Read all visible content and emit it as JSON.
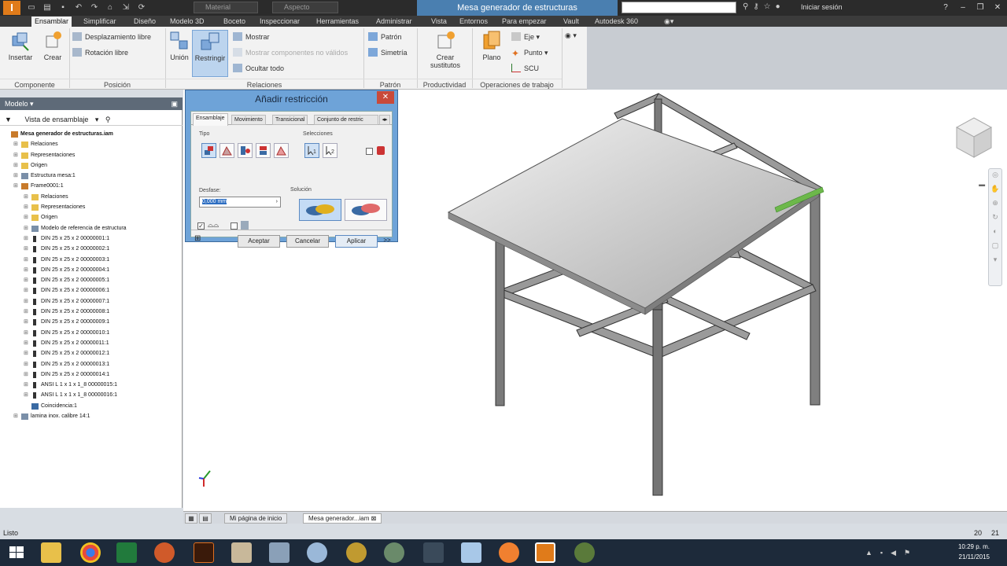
{
  "titlebar": {
    "app_logo": "I",
    "material_placeholder": "Material",
    "appearance_placeholder": "Aspecto",
    "title": "Mesa generador de estructuras",
    "sign_in": "Iniciar sesión"
  },
  "tabs": [
    "Ensamblar",
    "Simplificar",
    "Diseño",
    "Modelo 3D",
    "Boceto",
    "Inspeccionar",
    "Herramientas",
    "Administrar",
    "Vista",
    "Entornos",
    "Para empezar",
    "Vault",
    "Autodesk 360"
  ],
  "ribbon": {
    "insert": "Insertar",
    "create": "Crear",
    "free_move": "Desplazamiento libre",
    "free_rotate": "Rotación libre",
    "join": "Unión",
    "constrain": "Restringir",
    "show": "Mostrar",
    "show_disabled": "Mostrar componentes no válidos",
    "hide_all": "Ocultar todo",
    "pattern": "Patrón",
    "mirror": "Simetría",
    "create_subs_1": "Crear",
    "create_subs_2": "sustitutos",
    "plane": "Plano",
    "axis": "Eje",
    "point": "Punto",
    "ucs": "SCU",
    "panels": {
      "component": "Componente",
      "position": "Posición",
      "relations": "Relaciones",
      "pattern": "Patrón",
      "productivity": "Productividad",
      "work_features": "Operaciones de trabajo"
    }
  },
  "browser": {
    "header": "Modelo",
    "view": "Vista de ensamblaje",
    "tree": [
      {
        "label": "Mesa generador de estructuras.iam",
        "level": 0,
        "bold": true,
        "icon": "assembly-icon"
      },
      {
        "label": "Relaciones",
        "level": 1,
        "icon": "folder-icon"
      },
      {
        "label": "Representaciones",
        "level": 1,
        "icon": "folder-icon"
      },
      {
        "label": "Origen",
        "level": 1,
        "icon": "folder-icon"
      },
      {
        "label": "Estructura mesa:1",
        "level": 1,
        "icon": "part-icon"
      },
      {
        "label": "Frame0001:1",
        "level": 1,
        "icon": "assembly-icon"
      },
      {
        "label": "Relaciones",
        "level": 2,
        "icon": "folder-icon"
      },
      {
        "label": "Representaciones",
        "level": 2,
        "icon": "folder-icon"
      },
      {
        "label": "Origen",
        "level": 2,
        "icon": "folder-icon"
      },
      {
        "label": "Modelo de referencia de estructura",
        "level": 2,
        "icon": "part-icon"
      },
      {
        "label": "DIN 25 x 25 x 2 00000001:1",
        "level": 2,
        "icon": "beam-icon"
      },
      {
        "label": "DIN 25 x 25 x 2 00000002:1",
        "level": 2,
        "icon": "beam-icon"
      },
      {
        "label": "DIN 25 x 25 x 2 00000003:1",
        "level": 2,
        "icon": "beam-icon"
      },
      {
        "label": "DIN 25 x 25 x 2 00000004:1",
        "level": 2,
        "icon": "beam-icon"
      },
      {
        "label": "DIN 25 x 25 x 2 00000005:1",
        "level": 2,
        "icon": "beam-icon"
      },
      {
        "label": "DIN 25 x 25 x 2 00000006:1",
        "level": 2,
        "icon": "beam-icon"
      },
      {
        "label": "DIN 25 x 25 x 2 00000007:1",
        "level": 2,
        "icon": "beam-icon"
      },
      {
        "label": "DIN 25 x 25 x 2 00000008:1",
        "level": 2,
        "icon": "beam-icon"
      },
      {
        "label": "DIN 25 x 25 x 2 00000009:1",
        "level": 2,
        "icon": "beam-icon"
      },
      {
        "label": "DIN 25 x 25 x 2 00000010:1",
        "level": 2,
        "icon": "beam-icon"
      },
      {
        "label": "DIN 25 x 25 x 2 00000011:1",
        "level": 2,
        "icon": "beam-icon"
      },
      {
        "label": "DIN 25 x 25 x 2 00000012:1",
        "level": 2,
        "icon": "beam-icon"
      },
      {
        "label": "DIN 25 x 25 x 2 00000013:1",
        "level": 2,
        "icon": "beam-icon"
      },
      {
        "label": "DIN 25 x 25 x 2 00000014:1",
        "level": 2,
        "icon": "beam-icon"
      },
      {
        "label": "ANSI L 1 x 1 x 1_8 00000015:1",
        "level": 2,
        "icon": "beam-icon"
      },
      {
        "label": "ANSI L 1 x 1 x 1_8 00000016:1",
        "level": 2,
        "icon": "beam-icon"
      },
      {
        "label": "Coincidencia:1",
        "level": 2,
        "icon": "constraint-icon"
      },
      {
        "label": "lamina inox. calibre 14:1",
        "level": 1,
        "icon": "part-icon"
      }
    ]
  },
  "dialog": {
    "title": "Añadir restricción",
    "tabs": [
      "Ensamblaje",
      "Movimiento",
      "Transicional",
      "Conjunto de restric"
    ],
    "type_label": "Tipo",
    "selections_label": "Selecciones",
    "offset_label": "Desfase:",
    "offset_value": "0,000 mm",
    "solution_label": "Solución",
    "ok": "Aceptar",
    "cancel": "Cancelar",
    "apply": "Aplicar",
    "more": ">>"
  },
  "doc_tabs": [
    "Mi página de inicio",
    "Mesa generador...iam"
  ],
  "status": {
    "left": "Listo",
    "count_a": "20",
    "count_b": "21"
  },
  "clock": {
    "time": "10:29 p. m.",
    "date": "21/11/2015"
  }
}
